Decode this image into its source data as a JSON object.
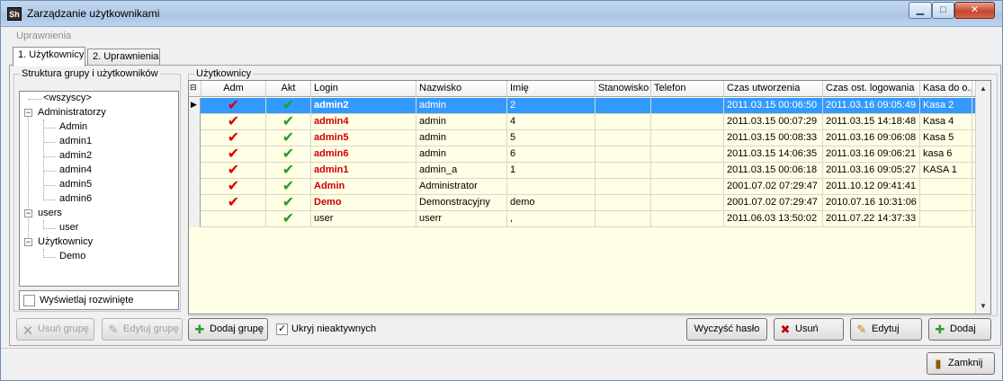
{
  "window": {
    "title": "Zarządzanie użytkownikami",
    "app_icon_text": "Sh"
  },
  "menu": {
    "item": "Uprawnienia"
  },
  "tabs": [
    {
      "label": "1. Użytkownicy"
    },
    {
      "label": "2. Uprawnienia"
    }
  ],
  "left_panel": {
    "legend": "Struktura grupy i użytkowników",
    "tree": [
      {
        "label": "<wszyscy>"
      },
      {
        "label": "Administratorzy"
      },
      {
        "label": "Admin"
      },
      {
        "label": "admin1"
      },
      {
        "label": "admin2"
      },
      {
        "label": "admin4"
      },
      {
        "label": "admin5"
      },
      {
        "label": "admin6"
      },
      {
        "label": "users"
      },
      {
        "label": "user"
      },
      {
        "label": "Użytkownicy"
      },
      {
        "label": "Demo"
      }
    ],
    "show_expanded_label": "Wyświetlaj rozwinięte"
  },
  "right_panel": {
    "legend": "Użytkownicy",
    "columns": [
      "Adm",
      "Akt",
      "Login",
      "Nazwisko",
      "Imię",
      "Stanowisko",
      "Telefon",
      "Czas utworzenia",
      "Czas ost. logowania",
      "Kasa do o..."
    ],
    "rows": [
      {
        "adm": "✔",
        "akt": "✔",
        "login": "admin2",
        "nazwisko": "admin",
        "imie": "2",
        "stanowisko": "",
        "telefon": "",
        "created": "2011.03.15 00:06:50",
        "last_login": "2011.03.16 09:05:49",
        "kasa": "Kasa 2"
      },
      {
        "adm": "✔",
        "akt": "✔",
        "login": "admin4",
        "nazwisko": "admin",
        "imie": "4",
        "stanowisko": "",
        "telefon": "",
        "created": "2011.03.15 00:07:29",
        "last_login": "2011.03.15 14:18:48",
        "kasa": "Kasa 4"
      },
      {
        "adm": "✔",
        "akt": "✔",
        "login": "admin5",
        "nazwisko": "admin",
        "imie": "5",
        "stanowisko": "",
        "telefon": "",
        "created": "2011.03.15 00:08:33",
        "last_login": "2011.03.16 09:06:08",
        "kasa": "Kasa 5"
      },
      {
        "adm": "✔",
        "akt": "✔",
        "login": "admin6",
        "nazwisko": "admin",
        "imie": "6",
        "stanowisko": "",
        "telefon": "",
        "created": "2011.03.15 14:06:35",
        "last_login": "2011.03.16 09:06:21",
        "kasa": "kasa 6"
      },
      {
        "adm": "✔",
        "akt": "✔",
        "login": "admin1",
        "nazwisko": "admin_a",
        "imie": "1",
        "stanowisko": "",
        "telefon": "",
        "created": "2011.03.15 00:06:18",
        "last_login": "2011.03.16 09:05:27",
        "kasa": "KASA 1"
      },
      {
        "adm": "✔",
        "akt": "✔",
        "login": "Admin",
        "nazwisko": "Administrator",
        "imie": "",
        "stanowisko": "",
        "telefon": "",
        "created": "2001.07.02 07:29:47",
        "last_login": "2011.10.12 09:41:41",
        "kasa": ""
      },
      {
        "adm": "✔",
        "akt": "✔",
        "login": "Demo",
        "nazwisko": "Demonstracyjny",
        "imie": "demo",
        "stanowisko": "",
        "telefon": "",
        "created": "2001.07.02 07:29:47",
        "last_login": "2010.07.16 10:31:06",
        "kasa": ""
      },
      {
        "adm": "",
        "akt": "✔",
        "login": "user",
        "nazwisko": "userr",
        "imie": ",",
        "stanowisko": "",
        "telefon": "",
        "created": "2011.06.03 13:50:02",
        "last_login": "2011.07.22 14:37:33",
        "kasa": ""
      }
    ]
  },
  "bottom_buttons": {
    "remove_group": "Usuń grupę",
    "edit_group": "Edytuj grupę",
    "add_group": "Dodaj grupę",
    "hide_inactive": "Ukryj nieaktywnych",
    "clear_password": "Wyczyść hasło",
    "remove": "Usuń",
    "edit": "Edytuj",
    "add": "Dodaj"
  },
  "footer": {
    "close": "Zamknij"
  },
  "colors": {
    "selected_row": "#3399ff",
    "admin_login": "#cc0000",
    "grid_background": "#ffffe6",
    "adm_tick": "#d60000",
    "akt_tick": "#22a022"
  }
}
